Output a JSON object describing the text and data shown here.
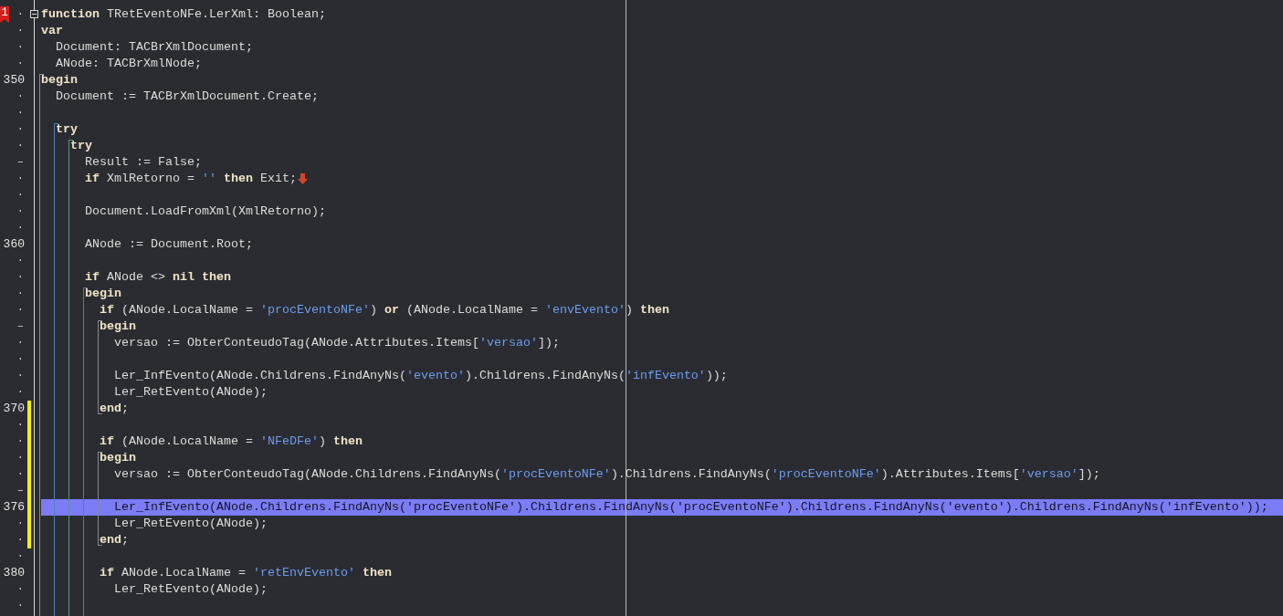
{
  "editor": {
    "lines": [
      {
        "marker": "·",
        "bookmark": "1",
        "foldable": true,
        "modified": false,
        "selected": false,
        "tokens": [
          {
            "text": "function",
            "kind": "keyword"
          },
          {
            "text": " TRetEventoNFe.LerXml: Boolean;",
            "kind": "text"
          }
        ]
      },
      {
        "marker": "·",
        "modified": false,
        "selected": false,
        "tokens": [
          {
            "text": "var",
            "kind": "keyword"
          }
        ]
      },
      {
        "marker": "·",
        "modified": false,
        "selected": false,
        "tokens": [
          {
            "text": "  Document: TACBrXmlDocument;",
            "kind": "text"
          }
        ]
      },
      {
        "marker": "·",
        "modified": false,
        "selected": false,
        "tokens": [
          {
            "text": "  ANode: TACBrXmlNode;",
            "kind": "text"
          }
        ]
      },
      {
        "number": "350",
        "modified": false,
        "selected": false,
        "tokens": [
          {
            "text": "begin",
            "kind": "keyword"
          }
        ]
      },
      {
        "marker": "·",
        "modified": false,
        "selected": false,
        "tokens": [
          {
            "text": "  Document := TACBrXmlDocument.Create;",
            "kind": "text"
          }
        ]
      },
      {
        "marker": "·",
        "modified": false,
        "selected": false
      },
      {
        "marker": "·",
        "modified": false,
        "selected": false,
        "tokens": [
          {
            "text": "  try",
            "kind": "keyword"
          }
        ]
      },
      {
        "marker": "·",
        "modified": false,
        "selected": false,
        "tokens": [
          {
            "text": "    try",
            "kind": "keyword"
          }
        ]
      },
      {
        "marker": "–",
        "modified": false,
        "selected": false,
        "tokens": [
          {
            "text": "      Result := False;",
            "kind": "text"
          }
        ]
      },
      {
        "marker": "·",
        "modified": false,
        "selected": false,
        "exit_marker": true,
        "tokens": [
          {
            "text": "      if",
            "kind": "keyword"
          },
          {
            "text": " XmlRetorno = ",
            "kind": "text"
          },
          {
            "text": "''",
            "kind": "string"
          },
          {
            "text": " then",
            "kind": "keyword"
          },
          {
            "text": " Exit;",
            "kind": "text"
          }
        ]
      },
      {
        "marker": "·",
        "modified": false,
        "selected": false
      },
      {
        "marker": "·",
        "modified": false,
        "selected": false,
        "tokens": [
          {
            "text": "      Document.LoadFromXml(XmlRetorno);",
            "kind": "text"
          }
        ]
      },
      {
        "marker": "·",
        "modified": false,
        "selected": false
      },
      {
        "number": "360",
        "modified": false,
        "selected": false,
        "tokens": [
          {
            "text": "      ANode := Document.Root;",
            "kind": "text"
          }
        ]
      },
      {
        "marker": "·",
        "modified": false,
        "selected": false
      },
      {
        "marker": "·",
        "modified": false,
        "selected": false,
        "tokens": [
          {
            "text": "      if",
            "kind": "keyword"
          },
          {
            "text": " ANode <> ",
            "kind": "text"
          },
          {
            "text": "nil then",
            "kind": "keyword"
          }
        ]
      },
      {
        "marker": "·",
        "modified": false,
        "selected": false,
        "tokens": [
          {
            "text": "      begin",
            "kind": "keyword"
          }
        ]
      },
      {
        "marker": "·",
        "modified": false,
        "selected": false,
        "tokens": [
          {
            "text": "        if",
            "kind": "keyword"
          },
          {
            "text": " (ANode.LocalName = ",
            "kind": "text"
          },
          {
            "text": "'procEventoNFe'",
            "kind": "string"
          },
          {
            "text": ") ",
            "kind": "text"
          },
          {
            "text": "or",
            "kind": "keyword"
          },
          {
            "text": " (ANode.LocalName = ",
            "kind": "text"
          },
          {
            "text": "'envEvento'",
            "kind": "string"
          },
          {
            "text": ") ",
            "kind": "text"
          },
          {
            "text": "then",
            "kind": "keyword"
          }
        ]
      },
      {
        "marker": "–",
        "modified": false,
        "selected": false,
        "tokens": [
          {
            "text": "        begin",
            "kind": "keyword"
          }
        ]
      },
      {
        "marker": "·",
        "modified": false,
        "selected": false,
        "tokens": [
          {
            "text": "          versao := ObterConteudoTag(ANode.Attributes.Items[",
            "kind": "text"
          },
          {
            "text": "'versao'",
            "kind": "string"
          },
          {
            "text": "]);",
            "kind": "text"
          }
        ]
      },
      {
        "marker": "·",
        "modified": false,
        "selected": false
      },
      {
        "marker": "·",
        "modified": false,
        "selected": false,
        "tokens": [
          {
            "text": "          Ler_InfEvento(ANode.Childrens.FindAnyNs(",
            "kind": "text"
          },
          {
            "text": "'evento'",
            "kind": "string"
          },
          {
            "text": ").Childrens.FindAnyNs(",
            "kind": "text"
          },
          {
            "text": "'infEvento'",
            "kind": "string"
          },
          {
            "text": "));",
            "kind": "text"
          }
        ]
      },
      {
        "marker": "·",
        "modified": false,
        "selected": false,
        "tokens": [
          {
            "text": "          Ler_RetEvento(ANode);",
            "kind": "text"
          }
        ]
      },
      {
        "number": "370",
        "modified": true,
        "selected": false,
        "tokens": [
          {
            "text": "        end",
            "kind": "keyword"
          },
          {
            "text": ";",
            "kind": "text"
          }
        ]
      },
      {
        "marker": "·",
        "modified": true,
        "selected": false
      },
      {
        "marker": "·",
        "modified": true,
        "selected": false,
        "tokens": [
          {
            "text": "        if",
            "kind": "keyword"
          },
          {
            "text": " (ANode.LocalName = ",
            "kind": "text"
          },
          {
            "text": "'NFeDFe'",
            "kind": "string"
          },
          {
            "text": ") ",
            "kind": "text"
          },
          {
            "text": "then",
            "kind": "keyword"
          }
        ]
      },
      {
        "marker": "·",
        "modified": true,
        "selected": false,
        "tokens": [
          {
            "text": "        begin",
            "kind": "keyword"
          }
        ]
      },
      {
        "marker": "·",
        "modified": true,
        "selected": false,
        "tokens": [
          {
            "text": "          versao := ObterConteudoTag(ANode.Childrens.FindAnyNs(",
            "kind": "text"
          },
          {
            "text": "'procEventoNFe'",
            "kind": "string"
          },
          {
            "text": ").Childrens.FindAnyNs(",
            "kind": "text"
          },
          {
            "text": "'procEventoNFe'",
            "kind": "string"
          },
          {
            "text": ").Attributes.Items[",
            "kind": "text"
          },
          {
            "text": "'versao'",
            "kind": "string"
          },
          {
            "text": "]);",
            "kind": "text"
          }
        ]
      },
      {
        "marker": "–",
        "modified": true,
        "selected": false
      },
      {
        "number": "376",
        "modified": true,
        "selected": true,
        "tokens": [
          {
            "text": "          Ler_InfEvento(ANode.Childrens.FindAnyNs(",
            "kind": "text"
          },
          {
            "text": "'procEventoNFe'",
            "kind": "string"
          },
          {
            "text": ").Childrens.FindAnyNs(",
            "kind": "text"
          },
          {
            "text": "'procEventoNFe'",
            "kind": "string"
          },
          {
            "text": ").",
            "kind": "text"
          },
          {
            "kind": "caret"
          },
          {
            "text": "Childrens.FindAnyNs(",
            "kind": "text"
          },
          {
            "text": "'evento'",
            "kind": "string"
          },
          {
            "text": ").Childrens.FindAnyNs(",
            "kind": "text"
          },
          {
            "text": "'infEvento'",
            "kind": "string"
          },
          {
            "text": "));",
            "kind": "text"
          }
        ]
      },
      {
        "marker": "·",
        "modified": true,
        "selected": false,
        "tokens": [
          {
            "text": "          Ler_RetEvento(ANode);",
            "kind": "text"
          }
        ]
      },
      {
        "marker": "·",
        "modified": true,
        "selected": false,
        "tokens": [
          {
            "text": "        end",
            "kind": "keyword"
          },
          {
            "text": ";",
            "kind": "text"
          }
        ]
      },
      {
        "marker": "·",
        "modified": false,
        "selected": false
      },
      {
        "number": "380",
        "modified": false,
        "selected": false,
        "tokens": [
          {
            "text": "        if",
            "kind": "keyword"
          },
          {
            "text": " ANode.LocalName = ",
            "kind": "text"
          },
          {
            "text": "'retEnvEvento'",
            "kind": "string"
          },
          {
            "text": " then",
            "kind": "keyword"
          }
        ]
      },
      {
        "marker": "·",
        "modified": false,
        "selected": false,
        "tokens": [
          {
            "text": "          Ler_RetEvento(ANode);",
            "kind": "text"
          }
        ]
      },
      {
        "marker": "·",
        "modified": false,
        "selected": false
      }
    ]
  }
}
